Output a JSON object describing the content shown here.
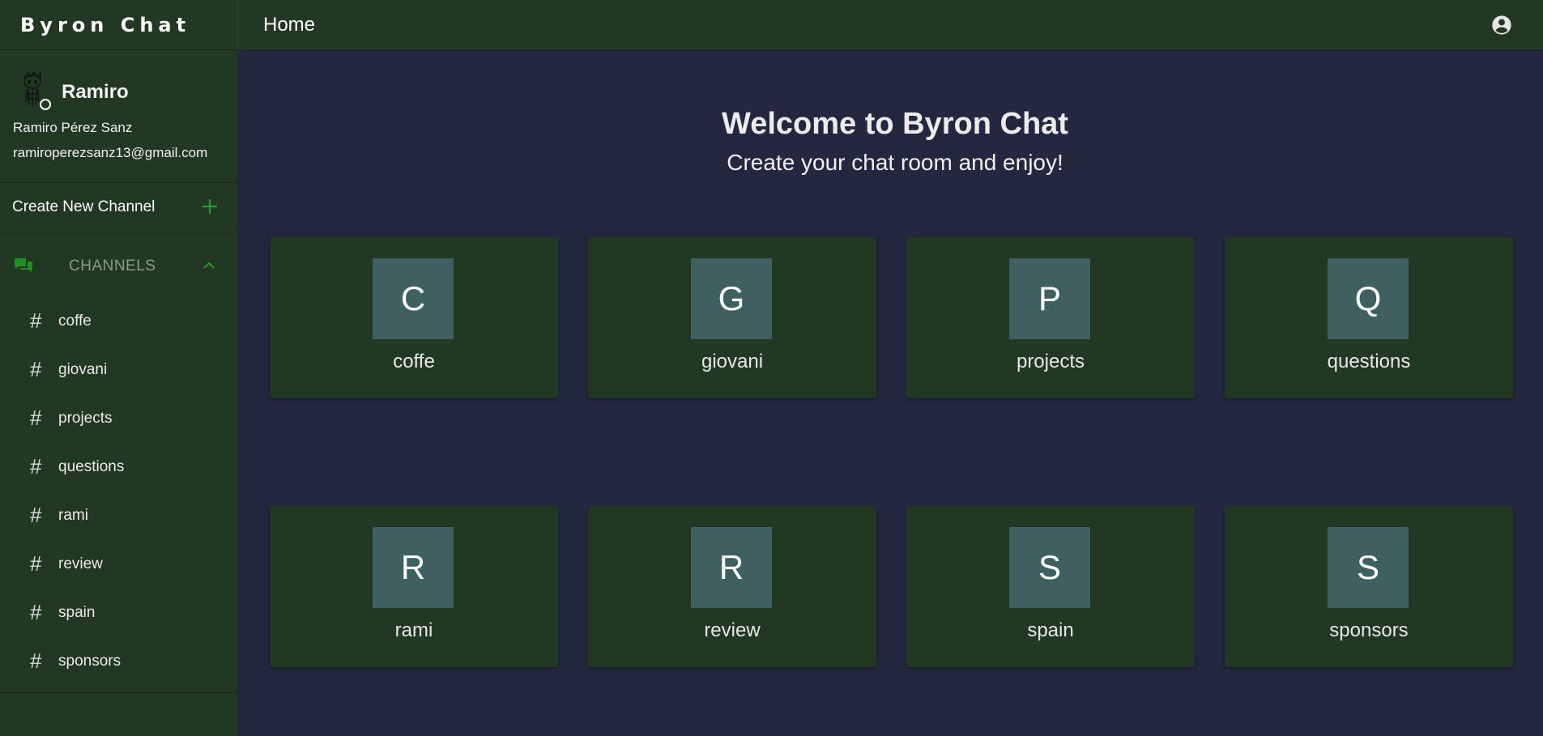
{
  "app": {
    "brand": "Byron Chat",
    "page_title": "Home"
  },
  "colors": {
    "bar": "#223822",
    "main_bg": "#232840",
    "tile": "#3f6060",
    "accent_green": "#2e9b2e"
  },
  "user": {
    "name": "Ramiro",
    "full_name": "Ramiro Pérez Sanz",
    "email": "ramiroperezsanz13@gmail.com",
    "status": "online"
  },
  "sidebar": {
    "create_channel_label": "Create New Channel",
    "channels_header": "CHANNELS",
    "channels": [
      {
        "label": "coffe"
      },
      {
        "label": "giovani"
      },
      {
        "label": "projects"
      },
      {
        "label": "questions"
      },
      {
        "label": "rami"
      },
      {
        "label": "review"
      },
      {
        "label": "spain"
      },
      {
        "label": "sponsors"
      }
    ]
  },
  "main": {
    "welcome_title": "Welcome to Byron Chat",
    "welcome_subtitle": "Create your chat room and enjoy!",
    "cards": [
      {
        "initial": "C",
        "label": "coffe"
      },
      {
        "initial": "G",
        "label": "giovani"
      },
      {
        "initial": "P",
        "label": "projects"
      },
      {
        "initial": "Q",
        "label": "questions"
      },
      {
        "initial": "R",
        "label": "rami"
      },
      {
        "initial": "R",
        "label": "review"
      },
      {
        "initial": "S",
        "label": "spain"
      },
      {
        "initial": "S",
        "label": "sponsors"
      }
    ]
  },
  "icons": {
    "account": "account-circle-icon",
    "add": "plus-icon",
    "channels": "chat-bubbles-icon",
    "collapse": "chevron-up-icon",
    "channel_prefix": "hash-icon"
  }
}
